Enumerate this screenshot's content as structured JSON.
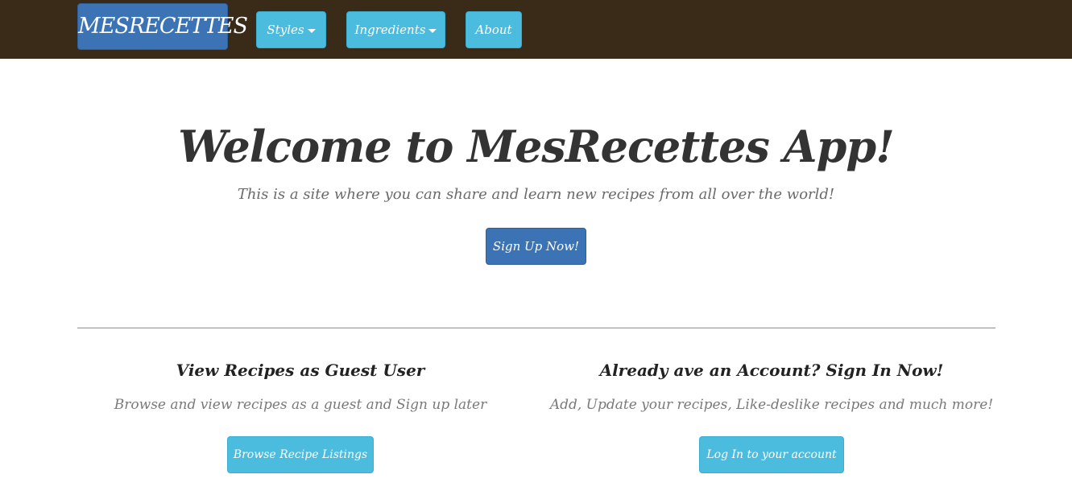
{
  "navbar": {
    "brand": "MESRECETTES",
    "items": [
      {
        "label": "Styles",
        "dropdown": true
      },
      {
        "label": "Ingredients",
        "dropdown": true
      },
      {
        "label": "About",
        "dropdown": false
      }
    ]
  },
  "hero": {
    "title": "Welcome to MesRecettes App!",
    "subtitle": "This is a site where you can share and learn new recipes from all over the world!",
    "cta_label": "Sign Up Now!"
  },
  "columns": [
    {
      "title": "View Recipes as Guest User",
      "description": "Browse and view recipes as a guest and Sign up later",
      "button_label": "Browse Recipe Listings"
    },
    {
      "title": "Already ave an Account? Sign In Now!",
      "description": "Add, Update your recipes, Like-deslike recipes and much more!",
      "button_label": "Log In to your account"
    }
  ],
  "colors": {
    "navbar_bg": "#3a2a18",
    "primary": "#3b73b5",
    "info": "#4bbcde",
    "text_dark": "#333333",
    "text_muted": "#7a7a7a"
  }
}
